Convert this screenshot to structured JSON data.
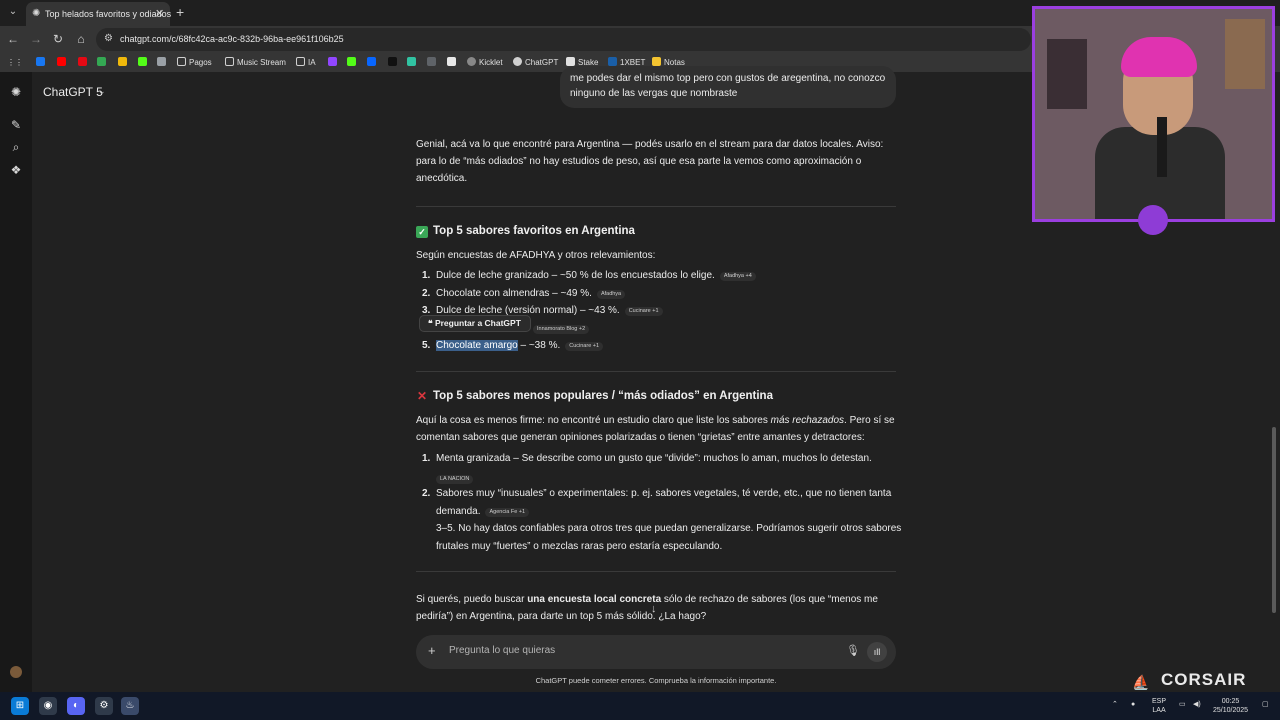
{
  "browser": {
    "tab_title": "Top helados favoritos y odiados",
    "url": "chatgpt.com/c/68fc42ca-ac9c-832b-96ba-ee961f106b25",
    "bookmarks": [
      "Pagos",
      "Music Stream",
      "IA",
      "Kicklet",
      "ChatGPT",
      "Stake",
      "1XBET",
      "Notas"
    ]
  },
  "app": {
    "model": "ChatGPT 5",
    "user_message": "me podes dar el mismo top pero con gustos de aregentina, no conozco ninguno de las vergas que nombraste",
    "intro": "Genial, acá va lo que encontré para Argentina — podés usarlo en el stream para dar datos locales. Aviso: para lo de “más odiados” no hay estudios de peso, así que esa parte la vemos como aproximación o anecdótica.",
    "section1": {
      "heading": "Top 5 sabores favoritos en Argentina",
      "lead": "Según encuestas de AFADHYA y otros relevamientos:",
      "items": [
        {
          "num": "1.",
          "text": "Dulce de leche granizado – ~50 % de los encuestados lo elige.",
          "chip": "Afadhya +4"
        },
        {
          "num": "2.",
          "text": "Chocolate con almendras – ~49 %.",
          "chip": "Afadhya"
        },
        {
          "num": "3.",
          "text": "Dulce de leche (versión normal) – ~43 %.",
          "chip": "Cucinare +1"
        },
        {
          "num": "4.",
          "text": "",
          "chip": "Innamorato Blog +2"
        },
        {
          "num": "5.",
          "text_selected": "Chocolate amargo",
          "text": " – ~38 %.",
          "chip": "Cucinare +1"
        }
      ],
      "popover": "Preguntar a ChatGPT"
    },
    "section2": {
      "heading": "Top 5 sabores menos populares / “más odiados” en Argentina",
      "lead_a": "Aquí la cosa es menos firme: no encontré un estudio claro que liste los sabores ",
      "lead_em": "más rechazados",
      "lead_b": ". Pero sí se comentan sabores que generan opiniones polarizadas o tienen “grietas” entre amantes y detractores:",
      "items": [
        {
          "num": "1.",
          "text": "Menta granizada – Se describe como un gusto que “divide”: muchos lo aman, muchos lo detestan.",
          "chip": "LA NACION"
        },
        {
          "num": "2.",
          "text_a": "Sabores muy “inusuales” o experimentales: p. ej. sabores vegetales, té verde, etc., que no tienen tanta",
          "text_b": "demanda.",
          "chip": "Agencia Fe +1"
        }
      ],
      "note_a": "3–5. No hay datos confiables para otros tres que puedan generalizarse. Podríamos sugerir otros sabores",
      "note_b": "frutales muy “fuertes” o mezclas raras pero estaría especulando."
    },
    "closing_a": "Si querés, puedo buscar ",
    "closing_bold": "una encuesta local concreta",
    "closing_b": " sólo de rechazo de sabores (los que “menos me",
    "closing_c": "pediría”) en Argentina, para darte un top 5 más sólido. ¿La hago?",
    "composer_placeholder": "Pregunta lo que quieras",
    "disclaimer": "ChatGPT puede cometer errores. Comprueba la información importante."
  },
  "overlay": {
    "brand": "CORSAIR"
  },
  "taskbar": {
    "lang_a": "ESP",
    "lang_b": "LAA",
    "time": "00:25",
    "date": "25/10/2025"
  },
  "colors": {
    "accent_purple": "#9b3fe0",
    "selection": "#3b5f8a",
    "check_green": "#3aa757",
    "cross_red": "#d9363e"
  }
}
